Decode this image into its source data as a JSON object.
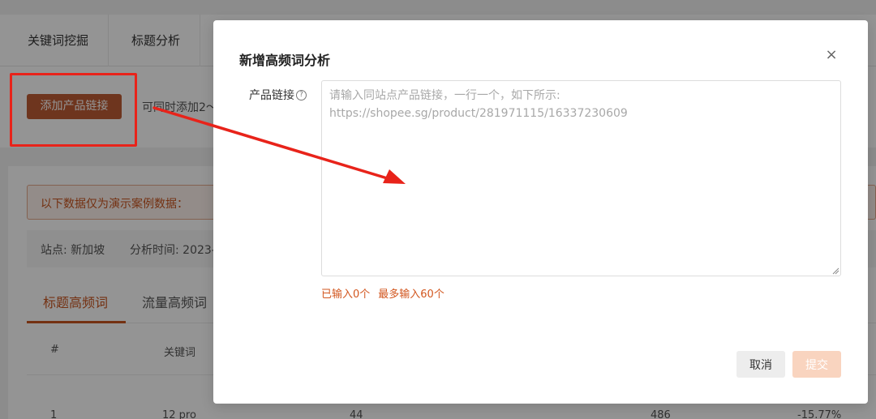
{
  "top_tabs": [
    "关键词挖掘",
    "标题分析"
  ],
  "action_bar": {
    "add_button": "添加产品链接",
    "hint": "可同时添加2～"
  },
  "notice": "以下数据仅为演示案例数据：",
  "meta": {
    "site": "站点: 新加坡",
    "time": "分析时间: 2023-"
  },
  "sub_tabs": [
    "标题高频词",
    "流量高频词"
  ],
  "table": {
    "headers": [
      "#",
      "关键词"
    ],
    "first_row": [
      "1",
      "12 pro",
      "44",
      "486",
      "-15.77%"
    ]
  },
  "modal": {
    "title": "新增高频词分析",
    "close_icon": "close-icon",
    "field_label": "产品链接",
    "placeholder": "请输入同站点产品链接，一行一个，如下所示:\nhttps://shopee.sg/product/281971115/16337230609",
    "counter_entered": "已输入0个",
    "counter_max": "最多输入60个",
    "cancel_label": "取消",
    "submit_label": "提交"
  },
  "colors": {
    "accent": "#c8551f",
    "annotation_red": "#e8231a",
    "submit_disabled": "#f9d4bf"
  }
}
